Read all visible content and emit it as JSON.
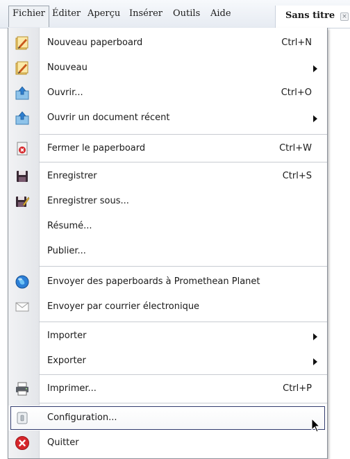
{
  "menubar": {
    "items": [
      "Fichier",
      "Éditer",
      "Aperçu",
      "Insérer",
      "Outils",
      "Aide"
    ],
    "tab_title": "Sans titre",
    "tab_close": "×"
  },
  "menu": {
    "items": [
      {
        "label": "Nouveau paperboard",
        "shortcut": "Ctrl+N",
        "icon": "new-paperboard-icon"
      },
      {
        "label": "Nouveau",
        "submenu": true,
        "icon": "new-icon"
      },
      {
        "label": "Ouvrir...",
        "shortcut": "Ctrl+O",
        "icon": "open-icon"
      },
      {
        "label": "Ouvrir un document récent",
        "submenu": true,
        "icon": "open-recent-icon"
      },
      {
        "label": "Fermer le paperboard",
        "shortcut": "Ctrl+W",
        "icon": "close-paperboard-icon"
      },
      {
        "label": "Enregistrer",
        "shortcut": "Ctrl+S",
        "icon": "save-icon"
      },
      {
        "label": "Enregistrer sous...",
        "icon": "save-as-icon"
      },
      {
        "label": "Résumé..."
      },
      {
        "label": "Publier..."
      },
      {
        "label": "Envoyer des paperboards à Promethean Planet",
        "icon": "globe-icon"
      },
      {
        "label": "Envoyer par courrier électronique",
        "icon": "mail-icon"
      },
      {
        "label": "Importer",
        "submenu": true
      },
      {
        "label": "Exporter",
        "submenu": true
      },
      {
        "label": "Imprimer...",
        "shortcut": "Ctrl+P",
        "icon": "printer-icon"
      },
      {
        "label": "Configuration...",
        "icon": "configuration-icon",
        "highlighted": true
      },
      {
        "label": "Quitter",
        "icon": "quit-icon"
      }
    ]
  },
  "colors": {
    "menubar_bg": "#e6ebf2",
    "gutter_bg": "#e9ebee",
    "highlight_border": "#323c6e",
    "quit_red": "#d6262b"
  }
}
